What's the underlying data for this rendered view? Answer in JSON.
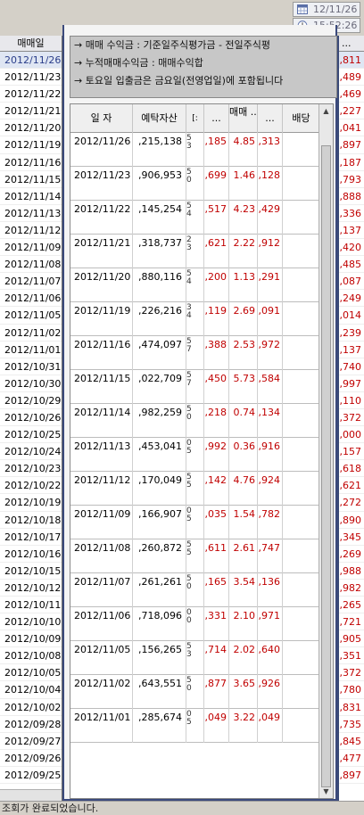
{
  "datetime": {
    "date": "12/11/26",
    "time": "15:52:26"
  },
  "left_panel": {
    "header": "매매일",
    "dates": [
      "2012/11/26",
      "2012/11/23",
      "2012/11/22",
      "2012/11/21",
      "2012/11/20",
      "2012/11/19",
      "2012/11/16",
      "2012/11/15",
      "2012/11/14",
      "2012/11/13",
      "2012/11/12",
      "2012/11/09",
      "2012/11/08",
      "2012/11/07",
      "2012/11/06",
      "2012/11/05",
      "2012/11/02",
      "2012/11/01",
      "2012/10/31",
      "2012/10/30",
      "2012/10/29",
      "2012/10/26",
      "2012/10/25",
      "2012/10/24",
      "2012/10/23",
      "2012/10/22",
      "2012/10/19",
      "2012/10/18",
      "2012/10/17",
      "2012/10/16",
      "2012/10/15",
      "2012/10/12",
      "2012/10/11",
      "2012/10/10",
      "2012/10/09",
      "2012/10/08",
      "2012/10/05",
      "2012/10/04",
      "2012/10/02",
      "2012/09/28",
      "2012/09/27",
      "2012/09/26",
      "2012/09/25"
    ]
  },
  "right_partial": {
    "header": "...",
    "values": [
      ",811",
      ",489",
      ",469",
      ",227",
      ",041",
      ",897",
      ",187",
      ",793",
      ",888",
      ",336",
      ",137",
      ",420",
      ",485",
      ",087",
      ",249",
      ",014",
      ",239",
      ",137",
      ",740",
      ",997",
      ",110",
      ",372",
      ",000",
      ",157",
      ",618",
      ",621",
      ",272",
      ",890",
      ",345",
      ",269",
      ",988",
      ",982",
      ",265",
      ",721",
      ",905",
      ",351",
      ",372",
      ",780",
      ",831",
      ",735",
      ",845",
      ",477",
      ",897"
    ]
  },
  "popup": {
    "info_lines": [
      "→ 매매  수익금   : 기준일주식평가금 - 전일주식평",
      "→ 누적매매수익금 : 매매수익합",
      "→ 토요일 입출금은 금요일(전영업일)에 포함됩니다"
    ],
    "columns": {
      "date": "일 자",
      "asset": "예탁자산",
      "narrow": "[:",
      "c1": "...",
      "c2": "매매 ...",
      "c3": "...",
      "c4": "배당"
    },
    "rows": [
      {
        "date": "2012/11/26",
        "asset": ",215,138",
        "narrow": "5\n3",
        "c1": ",185",
        "c2": "4.85",
        "c3": ",313"
      },
      {
        "date": "2012/11/23",
        "asset": ",906,953",
        "narrow": "5\n0",
        "c1": ",699",
        "c2": "1.46",
        "c3": ",128"
      },
      {
        "date": "2012/11/22",
        "asset": ",145,254",
        "narrow": "5\n4",
        "c1": ",517",
        "c2": "4.23",
        "c3": ",429"
      },
      {
        "date": "2012/11/21",
        "asset": ",318,737",
        "narrow": "2\n3",
        "c1": ",621",
        "c2": "2.22",
        "c3": ",912"
      },
      {
        "date": "2012/11/20",
        "asset": ",880,116",
        "narrow": "5\n4",
        "c1": ",200",
        "c2": "1.13",
        "c3": ",291"
      },
      {
        "date": "2012/11/19",
        "asset": ",226,216",
        "narrow": "3\n4",
        "c1": ",119",
        "c2": "2.69",
        "c3": ",091"
      },
      {
        "date": "2012/11/16",
        "asset": ",474,097",
        "narrow": "5\n7",
        "c1": ",388",
        "c2": "2.53",
        "c3": ",972"
      },
      {
        "date": "2012/11/15",
        "asset": ",022,709",
        "narrow": "5\n7",
        "c1": ",450",
        "c2": "5.73",
        "c3": ",584"
      },
      {
        "date": "2012/11/14",
        "asset": ",982,259",
        "narrow": "5\n0",
        "c1": ",218",
        "c2": "0.74",
        "c3": ",134"
      },
      {
        "date": "2012/11/13",
        "asset": ",453,041",
        "narrow": "0\n5",
        "c1": ",992",
        "c2": "0.36",
        "c3": ",916"
      },
      {
        "date": "2012/11/12",
        "asset": ",170,049",
        "narrow": "5\n5",
        "c1": ",142",
        "c2": "4.76",
        "c3": ",924"
      },
      {
        "date": "2012/11/09",
        "asset": ",166,907",
        "narrow": "0\n5",
        "c1": ",035",
        "c2": "1.54",
        "c3": ",782"
      },
      {
        "date": "2012/11/08",
        "asset": ",260,872",
        "narrow": "5\n5",
        "c1": ",611",
        "c2": "2.61",
        "c3": ",747"
      },
      {
        "date": "2012/11/07",
        "asset": ",261,261",
        "narrow": "5\n0",
        "c1": ",165",
        "c2": "3.54",
        "c3": ",136"
      },
      {
        "date": "2012/11/06",
        "asset": ",718,096",
        "narrow": "0\n0",
        "c1": ",331",
        "c2": "2.10",
        "c3": ",971"
      },
      {
        "date": "2012/11/05",
        "asset": ",156,265",
        "narrow": "5\n3",
        "c1": ",714",
        "c2": "2.02",
        "c3": ",640"
      },
      {
        "date": "2012/11/02",
        "asset": ",643,551",
        "narrow": "5\n0",
        "c1": ",877",
        "c2": "3.65",
        "c3": ",926"
      },
      {
        "date": "2012/11/01",
        "asset": ",285,674",
        "narrow": "0\n5",
        "c1": ",049",
        "c2": "3.22",
        "c3": ",049"
      }
    ]
  },
  "status_bar": {
    "text": "조회가 완료되었습니다."
  },
  "colors": {
    "negative": "#c00000",
    "selected_row": "#dfe6f3",
    "popup_border": "#3b4a7c"
  }
}
